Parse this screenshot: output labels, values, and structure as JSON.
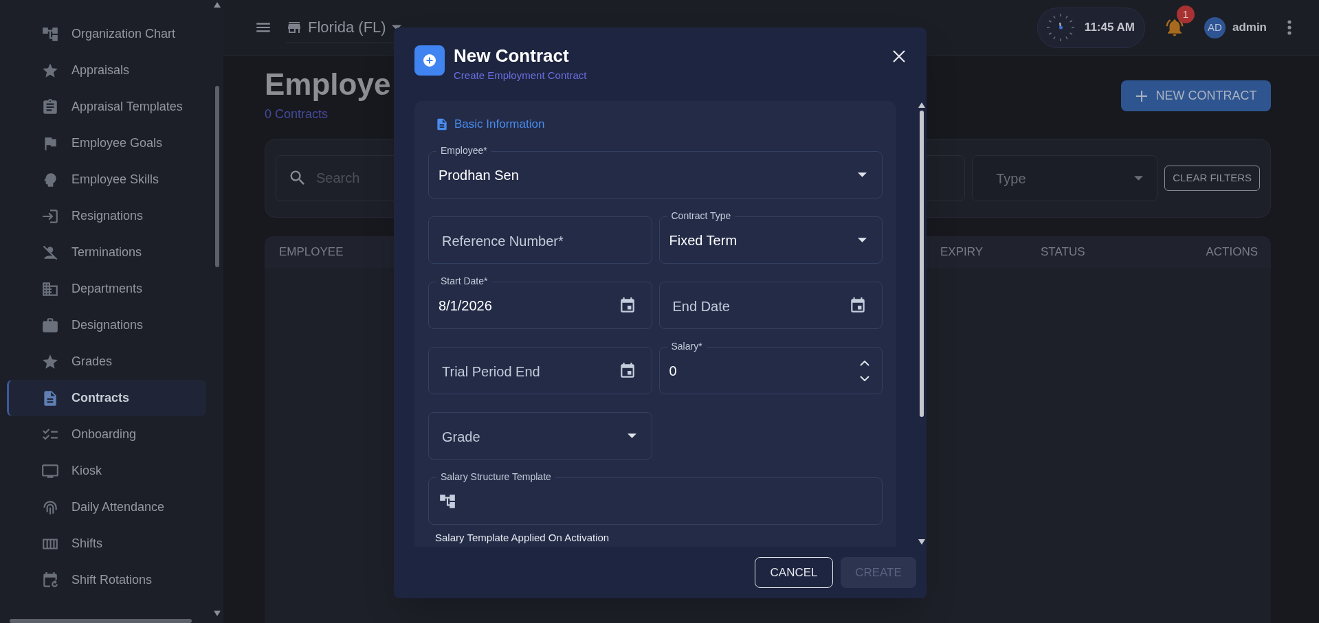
{
  "sidebar": {
    "items": [
      {
        "label": "Organization Chart",
        "selected": false
      },
      {
        "label": "Appraisals",
        "selected": false
      },
      {
        "label": "Appraisal Templates",
        "selected": false
      },
      {
        "label": "Employee Goals",
        "selected": false
      },
      {
        "label": "Employee Skills",
        "selected": false
      },
      {
        "label": "Resignations",
        "selected": false
      },
      {
        "label": "Terminations",
        "selected": false
      },
      {
        "label": "Departments",
        "selected": false
      },
      {
        "label": "Designations",
        "selected": false
      },
      {
        "label": "Grades",
        "selected": false
      },
      {
        "label": "Contracts",
        "selected": true
      },
      {
        "label": "Onboarding",
        "selected": false
      },
      {
        "label": "Kiosk",
        "selected": false
      },
      {
        "label": "Daily Attendance",
        "selected": false
      },
      {
        "label": "Shifts",
        "selected": false
      },
      {
        "label": "Shift Rotations",
        "selected": false
      }
    ]
  },
  "topbar": {
    "location": "Florida (FL)",
    "time": "11:45 AM",
    "notification_count": "1",
    "user_initials": "AD",
    "user_name": "admin"
  },
  "page": {
    "title": "Employe",
    "subtitle": "0 Contracts",
    "new_button": "NEW CONTRACT",
    "filters": {
      "search_placeholder": "Search",
      "type_select": "Type",
      "clear_button": "CLEAR FILTERS"
    },
    "table": {
      "columns": [
        "EMPLOYEE",
        "EXPIRY",
        "STATUS",
        "ACTIONS"
      ]
    }
  },
  "dialog": {
    "title": "New Contract",
    "subtitle": "Create Employment Contract",
    "section_title": "Basic Information",
    "fields": [
      {
        "kind": "select",
        "label": "Employee*",
        "value": "Prodhan Sen",
        "full_width": true
      },
      {
        "kind": "text",
        "label": "Reference Number*",
        "full_width": false
      },
      {
        "kind": "select",
        "label": "Contract Type",
        "value": "Fixed Term",
        "full_width": false
      },
      {
        "kind": "date",
        "label": "Start Date*",
        "value": "8/1/2026",
        "full_width": false
      },
      {
        "kind": "date",
        "label": "End Date",
        "full_width": false
      },
      {
        "kind": "date",
        "label": "Trial Period End",
        "full_width": false
      },
      {
        "kind": "number",
        "label": "Salary*",
        "value": "0",
        "full_width": false
      },
      {
        "kind": "select",
        "label": "Grade",
        "full_width": false
      },
      {
        "kind": "template",
        "label": "Salary Structure Template",
        "full_width": true
      }
    ],
    "helper_text": "Salary Template Applied On Activation",
    "buttons": [
      {
        "label": "CANCEL",
        "kind": "outlined",
        "disabled": false
      },
      {
        "label": "CREATE",
        "kind": "contained",
        "disabled": true
      }
    ]
  }
}
